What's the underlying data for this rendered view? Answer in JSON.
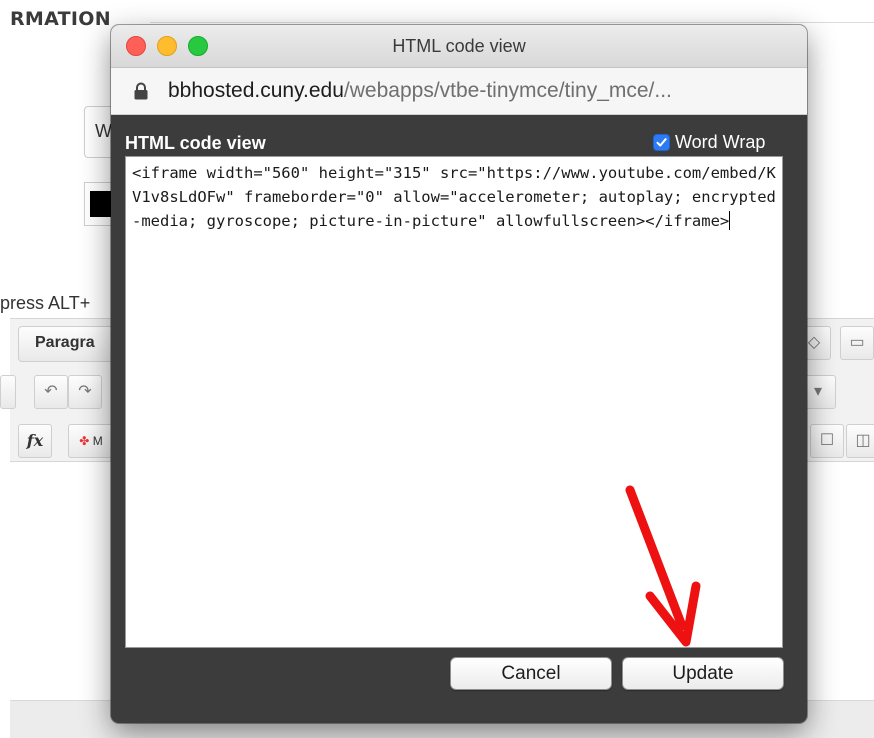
{
  "background": {
    "section_title": "RMATION",
    "input_partial": "W",
    "press_text": "press ALT+",
    "format_dropdown": "Paragra",
    "fx_label": "fx",
    "mashup_partial": "M"
  },
  "window": {
    "title": "HTML code view",
    "url_host": "bbhosted.cuny.edu",
    "url_path": "/webapps/vtbe-tinymce/tiny_mce/..."
  },
  "dialog": {
    "header": "HTML code view",
    "word_wrap_label": "Word Wrap",
    "word_wrap_checked": true,
    "code": "<iframe width=\"560\" height=\"315\" src=\"https://www.youtube.com/embed/KV1v8sLdOFw\" frameborder=\"0\" allow=\"accelerometer; autoplay; encrypted-media; gyroscope; picture-in-picture\" allowfullscreen></iframe>",
    "cancel_label": "Cancel",
    "update_label": "Update"
  },
  "colors": {
    "dialog_bg": "#3c3c3c",
    "checkbox_accent": "#2d7bf4",
    "arrow": "#ee1111"
  },
  "annotation": {
    "icon": "red-arrow-icon"
  }
}
